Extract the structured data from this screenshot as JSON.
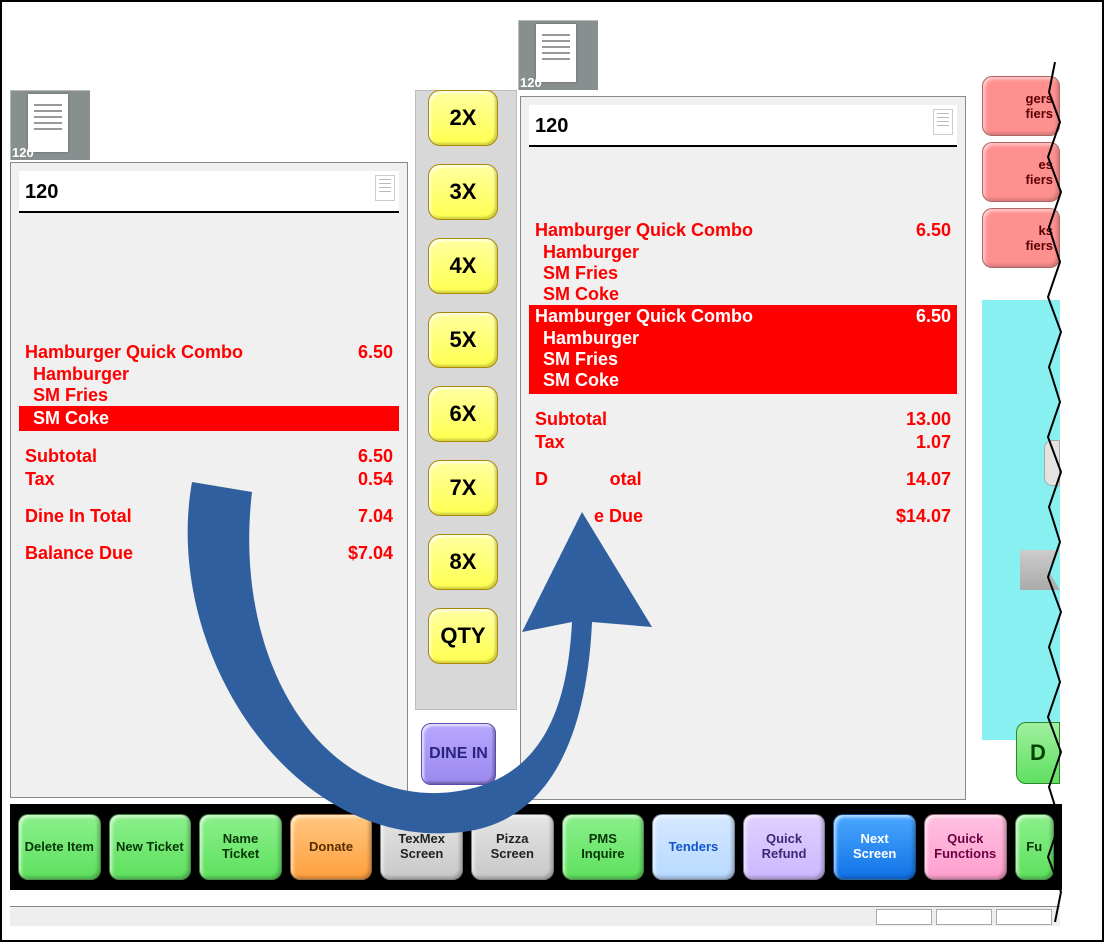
{
  "tabs": {
    "left": {
      "number": "120"
    },
    "right": {
      "number": "120"
    }
  },
  "qty_buttons": [
    "2X",
    "3X",
    "4X",
    "5X",
    "6X",
    "7X",
    "8X",
    "QTY"
  ],
  "dine_in_label": "DINE IN",
  "side_tabs": [
    {
      "line1": "gers",
      "line2": "fiers"
    },
    {
      "line1": "es",
      "line2": "fiers"
    },
    {
      "line1": "ks",
      "line2": "fiers"
    }
  ],
  "cyan_d_label": "D",
  "ticket_left": {
    "number": "120",
    "items": [
      {
        "name": "Hamburger Quick Combo",
        "price": "6.50",
        "subs": [
          "Hamburger",
          "SM Fries",
          "SM Coke"
        ],
        "hl_sub_index": 2
      }
    ],
    "subtotal_label": "Subtotal",
    "subtotal": "6.50",
    "tax_label": "Tax",
    "tax": "0.54",
    "total_label": "Dine In Total",
    "total": "7.04",
    "balance_label": "Balance Due",
    "balance": "$7.04"
  },
  "ticket_right": {
    "number": "120",
    "items": [
      {
        "name": "Hamburger Quick Combo",
        "price": "6.50",
        "subs": [
          "Hamburger",
          "SM Fries",
          "SM Coke"
        ],
        "highlighted": false
      },
      {
        "name": "Hamburger Quick Combo",
        "price": "6.50",
        "subs": [
          "Hamburger",
          "SM Fries",
          "SM Coke"
        ],
        "highlighted": true
      }
    ],
    "subtotal_label": "Subtotal",
    "subtotal": "13.00",
    "tax_label": "Tax",
    "tax": "1.07",
    "total_label": "Dine In Total",
    "total": "14.07",
    "total_hidden_prefix": "D",
    "total_hidden_suffix": "otal",
    "balance_label": "Balance Due",
    "balance": "$14.07",
    "balance_hidden_suffix": "Due"
  },
  "bottom_buttons": [
    {
      "label": "Delete Item",
      "cls": "c-green"
    },
    {
      "label": "New Ticket",
      "cls": "c-green"
    },
    {
      "label": "Name Ticket",
      "cls": "c-green"
    },
    {
      "label": "Donate",
      "cls": "c-orange"
    },
    {
      "label": "TexMex Screen",
      "cls": "c-gray"
    },
    {
      "label": "Pizza Screen",
      "cls": "c-gray"
    },
    {
      "label": "PMS Inquire",
      "cls": "c-green"
    },
    {
      "label": "Tenders",
      "cls": "c-blue-lite"
    },
    {
      "label": "Quick Refund",
      "cls": "c-lav"
    },
    {
      "label": "Next Screen",
      "cls": "c-blue"
    },
    {
      "label": "Quick Functions",
      "cls": "c-pink"
    },
    {
      "label": "Fu",
      "cls": "c-green"
    }
  ]
}
